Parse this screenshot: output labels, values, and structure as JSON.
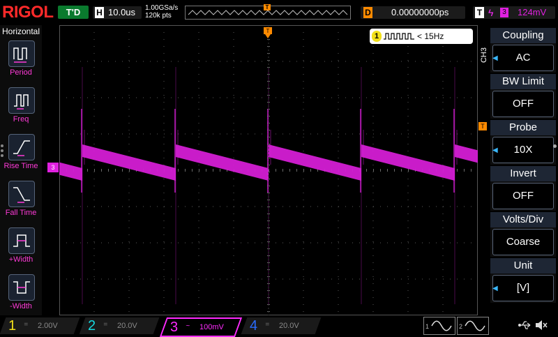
{
  "header": {
    "logo": "RIGOL",
    "trigger_status": "T'D",
    "horizontal": {
      "label": "H",
      "value": "10.0us"
    },
    "sample_rate": "1.00GSa/s",
    "memory_depth": "120k pts",
    "delay": {
      "label": "D",
      "value": "0.00000000ps"
    },
    "trigger": {
      "label": "T",
      "slope": "ϟ",
      "source": "3",
      "level": "124mV"
    }
  },
  "left_menu": {
    "title": "Horizontal",
    "items": [
      {
        "label": "Period",
        "icon": "period-icon"
      },
      {
        "label": "Freq",
        "icon": "frequency-icon"
      },
      {
        "label": "Rise Time",
        "icon": "rise-time-icon"
      },
      {
        "label": "Fall Time",
        "icon": "fall-time-icon"
      },
      {
        "label": "+Width",
        "icon": "positive-width-icon"
      },
      {
        "label": "-Width",
        "icon": "negative-width-icon"
      }
    ]
  },
  "screen": {
    "measurement": {
      "channel": "1",
      "icon": "pulse-train-icon",
      "value": "< 15Hz"
    },
    "trigger_marker": "T",
    "channel_marker": "3",
    "level_marker": "T",
    "waveform_color": "#d41ed4"
  },
  "right_menu": {
    "channel_label": "CH3",
    "items": [
      {
        "title": "Coupling",
        "value": "AC"
      },
      {
        "title": "BW Limit",
        "value": "OFF"
      },
      {
        "title": "Probe",
        "value": "10X"
      },
      {
        "title": "Invert",
        "value": "OFF"
      },
      {
        "title": "Volts/Div",
        "value": "Coarse"
      },
      {
        "title": "Unit",
        "value": "[V]"
      }
    ]
  },
  "footer": {
    "channels": [
      {
        "num": "1",
        "coupling": "=",
        "scale": "2.00V",
        "color": "#f2e01a"
      },
      {
        "num": "2",
        "coupling": "=",
        "scale": "20.0V",
        "color": "#16d8e0"
      },
      {
        "num": "3",
        "coupling": "~",
        "scale": "100mV",
        "color": "#ff2bff"
      },
      {
        "num": "4",
        "coupling": "=",
        "scale": "20.0V",
        "color": "#2a6cff"
      }
    ],
    "generators": [
      "1",
      "2"
    ]
  }
}
